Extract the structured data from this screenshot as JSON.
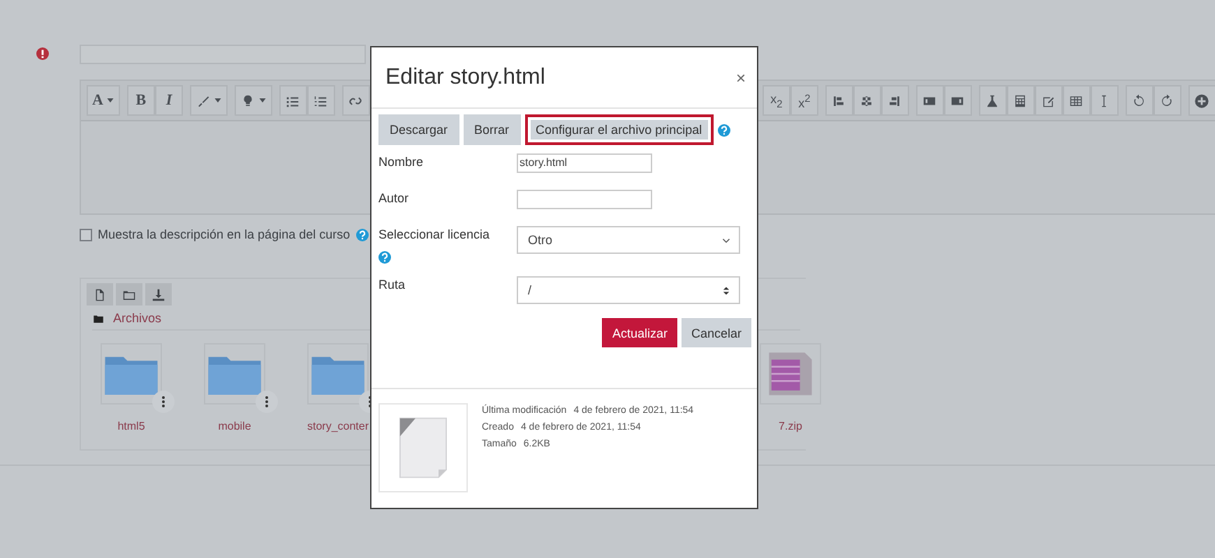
{
  "editor_toolbar": {
    "left": [
      [
        {
          "kind": "font",
          "label": "A"
        }
      ],
      [
        {
          "kind": "bold",
          "label": "B"
        },
        {
          "kind": "italic",
          "label": "I"
        }
      ],
      [
        {
          "kind": "brush"
        }
      ],
      [
        {
          "kind": "bulb"
        }
      ],
      [
        {
          "kind": "ul"
        },
        {
          "kind": "ol"
        }
      ],
      [
        {
          "kind": "link"
        }
      ]
    ],
    "right": [
      [
        {
          "kind": "script",
          "label": "x$_{2}$"
        },
        {
          "kind": "script",
          "label": "x$^{2}$"
        }
      ],
      [
        {
          "kind": "align-left"
        },
        {
          "kind": "align-center"
        },
        {
          "kind": "align-right"
        }
      ],
      [
        {
          "kind": "indent"
        },
        {
          "kind": "outdent"
        }
      ],
      [
        {
          "kind": "flask"
        },
        {
          "kind": "calculator"
        },
        {
          "kind": "edit"
        },
        {
          "kind": "table"
        },
        {
          "kind": "cursor"
        }
      ],
      [
        {
          "kind": "undo"
        },
        {
          "kind": "redo"
        }
      ],
      [
        {
          "kind": "plus"
        }
      ]
    ]
  },
  "show_description": {
    "label": "Muestra la descripción en la página del curso",
    "checked": false
  },
  "file_manager": {
    "toolbar": [
      {
        "kind": "file"
      },
      {
        "kind": "folder"
      },
      {
        "kind": "download"
      }
    ],
    "breadcrumb": "Archivos",
    "items": [
      {
        "kind": "folder",
        "name": "html5"
      },
      {
        "kind": "folder",
        "name": "mobile"
      },
      {
        "kind": "folder",
        "name": "story_conter"
      },
      {
        "kind": "zip",
        "name": "7.zip"
      }
    ]
  },
  "dialog": {
    "title": "Editar story.html",
    "close": "×",
    "actions": [
      {
        "label": "Descargar",
        "highlighted": false
      },
      {
        "label": "Borrar",
        "highlighted": false
      },
      {
        "label": "Configurar el archivo principal",
        "highlighted": true
      }
    ],
    "fields": [
      {
        "kind": "text",
        "label": "Nombre",
        "value": "story.html"
      },
      {
        "kind": "text",
        "label": "Autor"
      },
      {
        "kind": "select",
        "label": "Seleccionar licencia",
        "value": "Otro",
        "help": true
      },
      {
        "kind": "spinner",
        "label": "Ruta",
        "value": "/"
      }
    ],
    "buttons": [
      {
        "label": "Actualizar",
        "primary": true
      },
      {
        "label": "Cancelar",
        "primary": false
      }
    ],
    "info": [
      {
        "label": "Última modificación",
        "value": "4 de febrero de 2021, 11:54"
      },
      {
        "label": "Creado",
        "value": "4 de febrero de 2021, 11:54"
      },
      {
        "label": "Tamaño",
        "value": "6.2KB"
      }
    ]
  }
}
